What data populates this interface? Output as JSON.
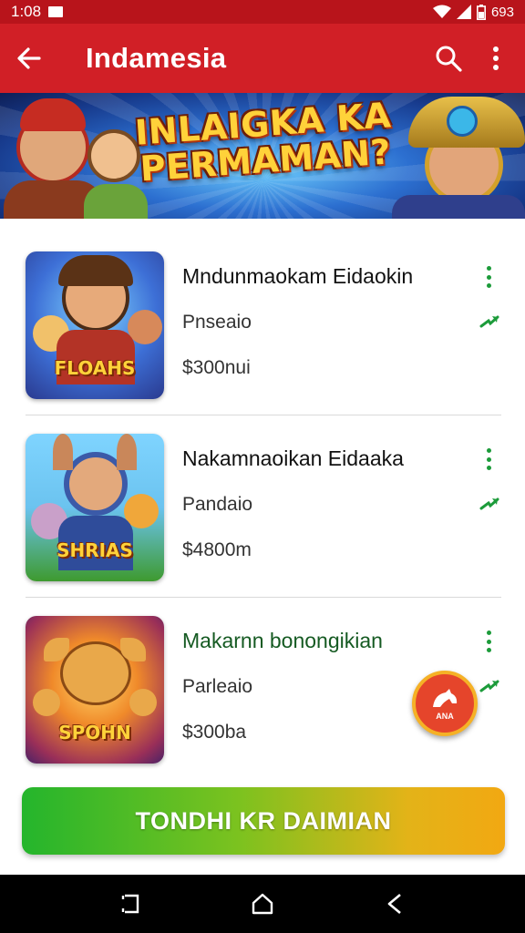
{
  "status_bar": {
    "time": "1:08",
    "battery": "693"
  },
  "app_bar": {
    "title": "Indamesia"
  },
  "banner": {
    "headline_line1": "INLAIGKA KA",
    "headline_line2": "PERMAMAN?"
  },
  "items": [
    {
      "title": "Mndunmaokam Eidaokin",
      "subtitle": "Pnseaio",
      "price": "$300nui",
      "thumb_label": "FLOAHS"
    },
    {
      "title": "Nakamnaoikan Eidaaka",
      "subtitle": "Pandaio",
      "price": "$4800m",
      "thumb_label": "SHRIAS"
    },
    {
      "title": "Makarnn bonongikian",
      "subtitle": "Parleaio",
      "price": "$300ba",
      "thumb_label": "SPOHN"
    }
  ],
  "fab": {
    "label": "ANA"
  },
  "cta": {
    "label": "TONDHI KR DAIMIAN"
  },
  "colors": {
    "app_bar": "#d11f26",
    "status_bar": "#b8141b",
    "accent_green": "#1c9b3a",
    "cta_start": "#24b52c",
    "cta_end": "#f2a812"
  },
  "icons": [
    "back-arrow-icon",
    "search-icon",
    "more-vert-icon",
    "wifi-icon",
    "signal-icon",
    "battery-icon",
    "recent-apps-icon",
    "home-icon",
    "back-nav-icon"
  ]
}
